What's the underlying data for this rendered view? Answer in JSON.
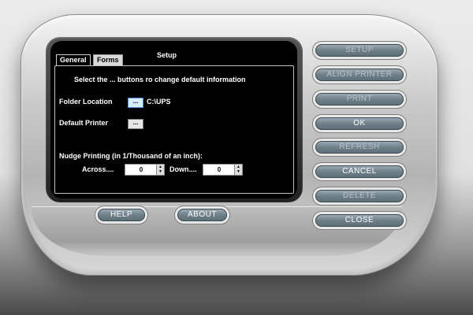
{
  "window": {
    "screen_title": "Setup",
    "tabs": [
      "General",
      "Forms"
    ]
  },
  "general": {
    "instruction": "Select the ... buttons ro change default information",
    "folder_location_label": "Folder Location",
    "folder_location_button": "...",
    "folder_location_value": "C:\\UPS",
    "default_printer_label": "Default Printer",
    "default_printer_button": "...",
    "nudge_label": "Nudge Printing (in 1/Thousand of an inch):",
    "across_label": "Across....",
    "across_value": "0",
    "down_label": "Down....",
    "down_value": "0"
  },
  "side_buttons": {
    "setup": "SETUP",
    "align_printer": "ALIGN PRINTER",
    "print": "PRINT",
    "ok": "OK",
    "refresh": "REFRESH",
    "cancel": "CANCEL",
    "delete": "DELETE",
    "close": "CLOSE"
  },
  "bottom_buttons": {
    "help": "HELP",
    "about": "ABOUT"
  }
}
